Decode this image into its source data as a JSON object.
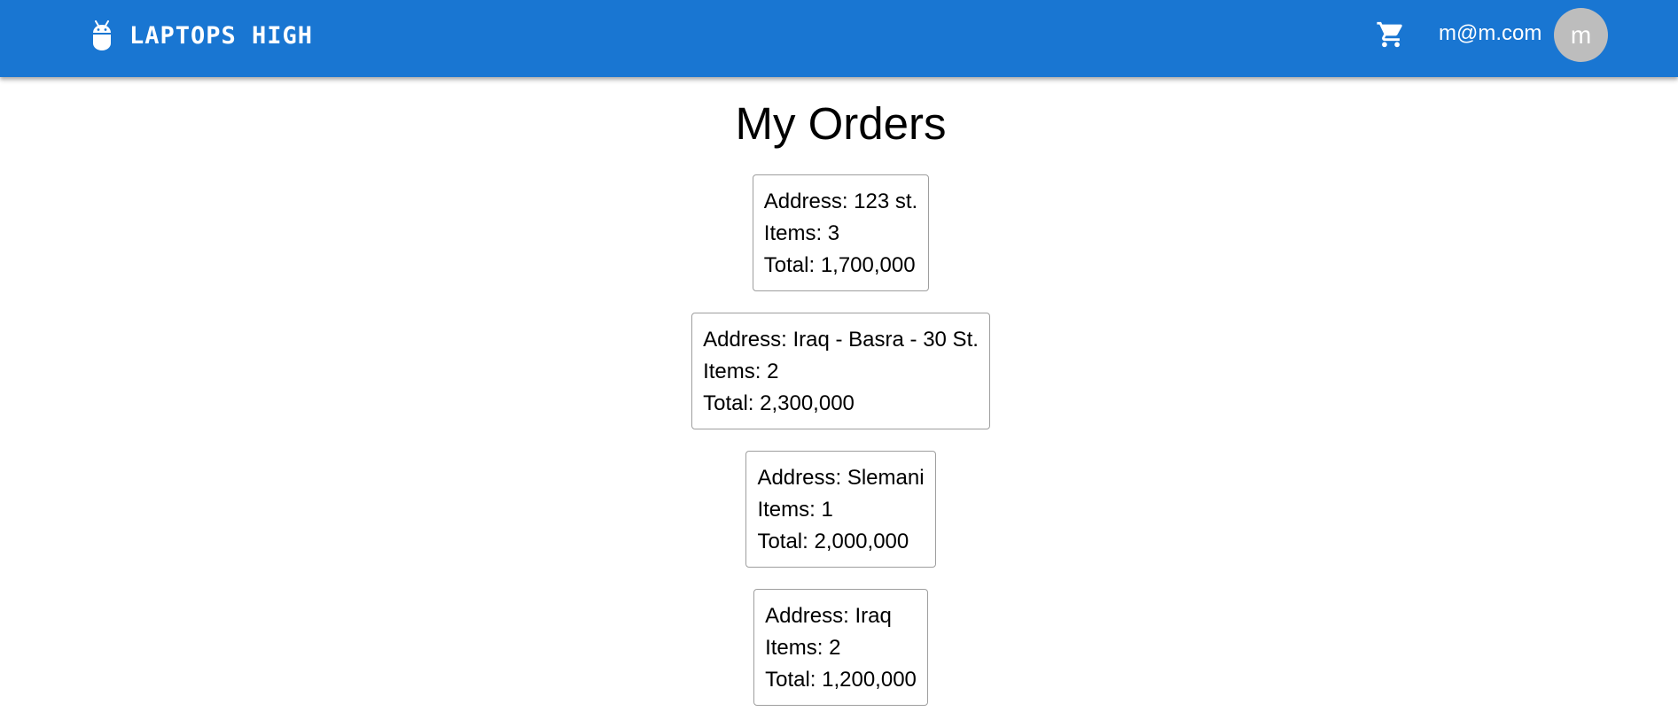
{
  "header": {
    "brand_title": "LAPTOPS HIGH",
    "brand_icon": "android-icon",
    "cart_icon": "shopping-cart-icon",
    "user_email": "m@m.com",
    "avatar_letter": "m",
    "colors": {
      "appbar": "#1976d2",
      "avatar_bg": "#bdbdbd"
    }
  },
  "main": {
    "title": "My Orders",
    "labels": {
      "address": "Address: ",
      "items": "Items: ",
      "total": "Total: "
    },
    "orders": [
      {
        "address": "123 st.",
        "items": "3",
        "total": "1,700,000"
      },
      {
        "address": "Iraq - Basra - 30 St.",
        "items": "2",
        "total": "2,300,000"
      },
      {
        "address": "Slemani",
        "items": "1",
        "total": "2,000,000"
      },
      {
        "address": "Iraq",
        "items": "2",
        "total": "1,200,000"
      }
    ]
  }
}
